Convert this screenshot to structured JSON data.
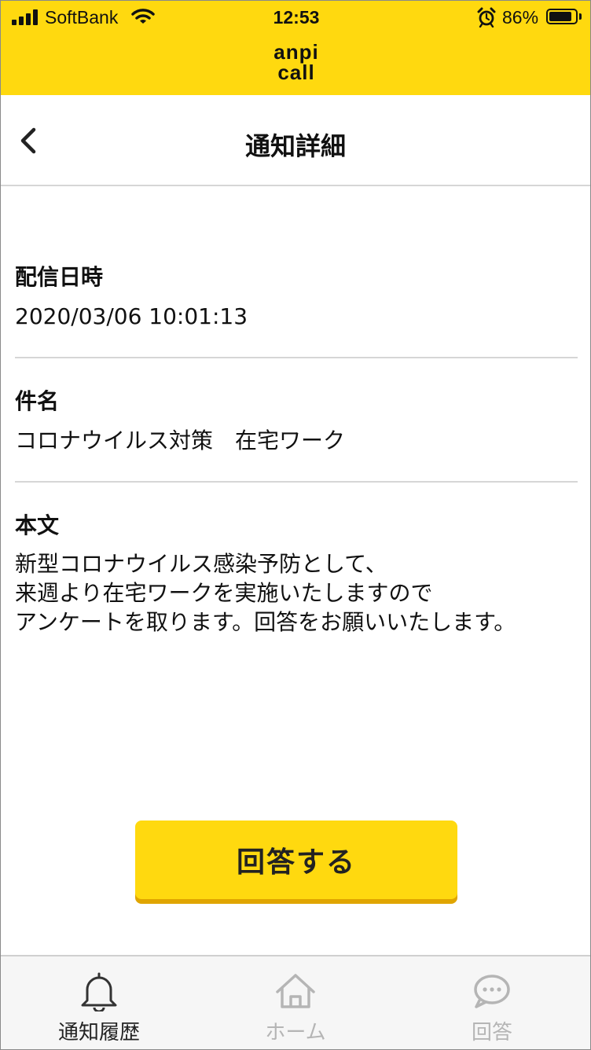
{
  "status_bar": {
    "carrier": "SoftBank",
    "time": "12:53",
    "battery": "86%",
    "battery_level": 0.86,
    "icons": [
      "signal-icon",
      "wifi-icon",
      "alarm-icon",
      "battery-icon"
    ]
  },
  "header": {
    "logo_line1": "anpi",
    "logo_line2": "call",
    "background": "#FFD90F"
  },
  "nav": {
    "title": "通知詳細",
    "back_icon": "chevron-left-icon"
  },
  "detail": {
    "sections": [
      {
        "label": "配信日時",
        "value": "2020/03/06 10:01:13"
      },
      {
        "label": "件名",
        "value": "コロナウイルス対策　在宅ワーク"
      },
      {
        "label": "本文",
        "value": "新型コロナウイルス感染予防として、\n来週より在宅ワークを実施いたしますので\nアンケートを取ります。回答をお願いいたします。"
      }
    ]
  },
  "action": {
    "answer_label": "回答する",
    "button_color": "#FFD90F"
  },
  "tabbar": {
    "tabs": [
      {
        "label": "通知履歴",
        "icon": "bell-icon",
        "active": true
      },
      {
        "label": "ホーム",
        "icon": "home-icon",
        "active": false
      },
      {
        "label": "回答",
        "icon": "chat-bubble-icon",
        "active": false
      }
    ]
  }
}
